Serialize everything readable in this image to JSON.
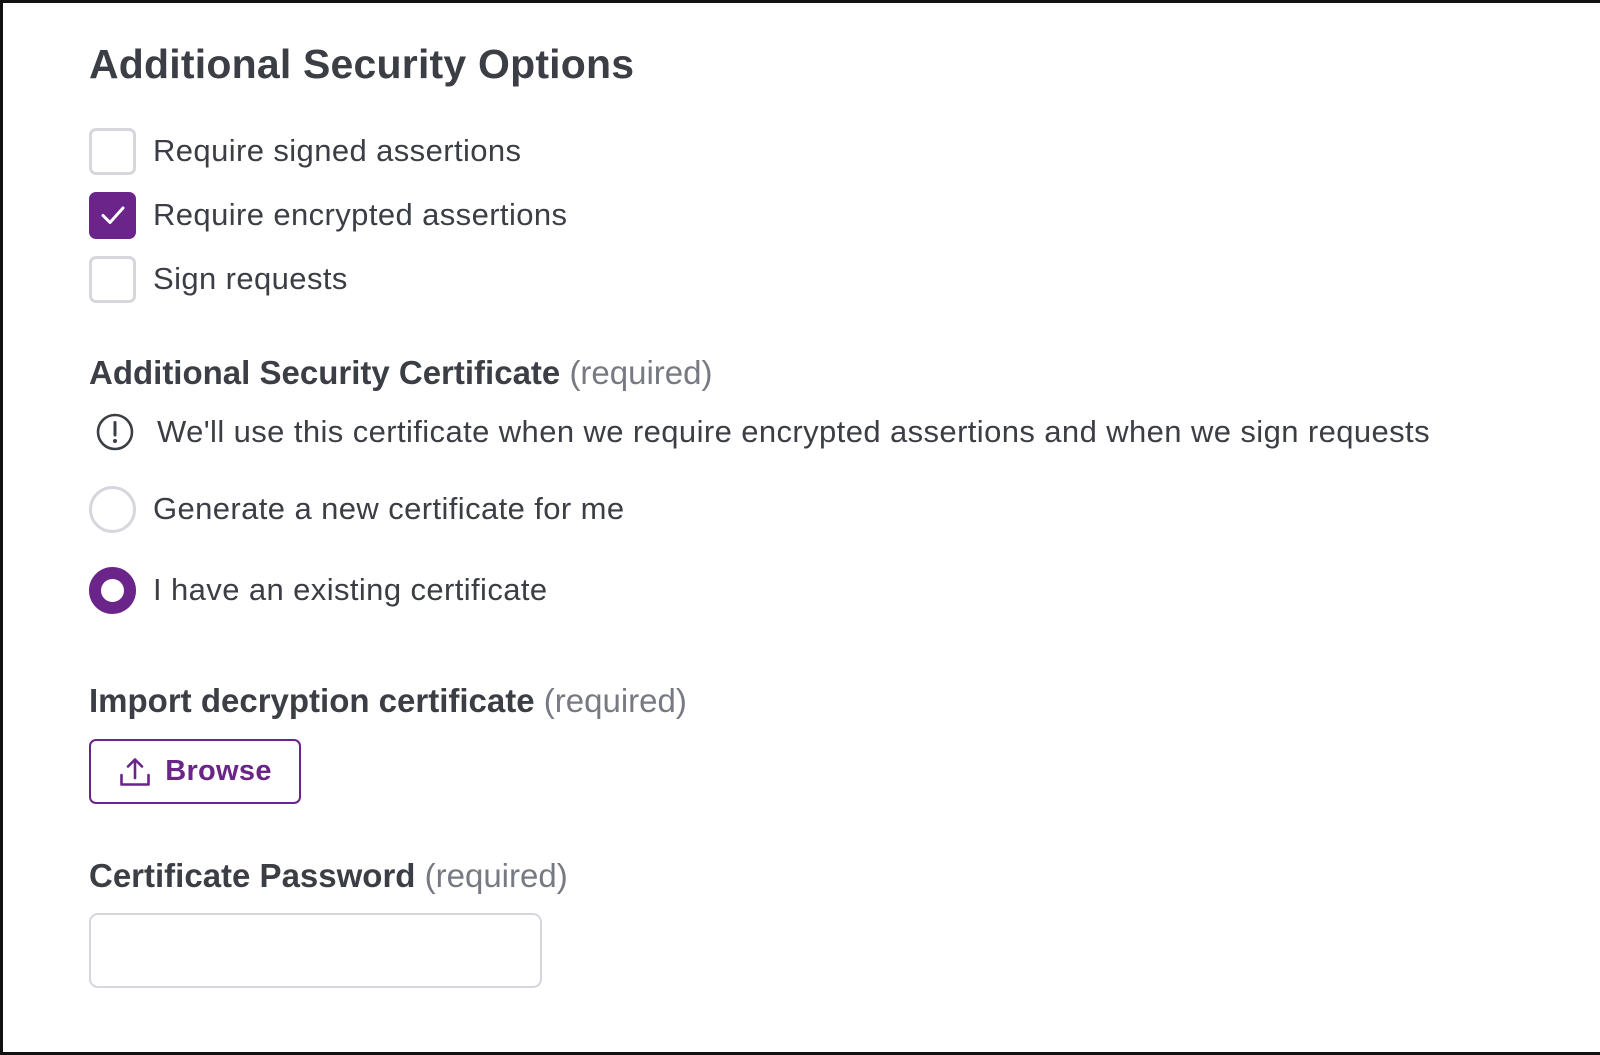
{
  "security_options": {
    "title": "Additional Security Options",
    "checkboxes": [
      {
        "label": "Require signed assertions",
        "checked": false
      },
      {
        "label": "Require encrypted assertions",
        "checked": true
      },
      {
        "label": "Sign requests",
        "checked": false
      }
    ]
  },
  "certificate": {
    "label": "Additional Security Certificate",
    "required_hint": "(required)",
    "info_text": "We'll use this certificate when we require encrypted assertions and when we sign requests",
    "radio_options": [
      {
        "label": "Generate a new certificate for me",
        "selected": false
      },
      {
        "label": "I have an existing certificate",
        "selected": true
      }
    ]
  },
  "import": {
    "label": "Import decryption certificate",
    "required_hint": "(required)",
    "browse_label": "Browse",
    "browse_icon": "upload-icon"
  },
  "password": {
    "label": "Certificate Password",
    "required_hint": "(required)",
    "value": ""
  },
  "colors": {
    "accent": "#6b2489",
    "text": "#3b3e45",
    "muted": "#777a82",
    "border": "#d5d7dd"
  }
}
